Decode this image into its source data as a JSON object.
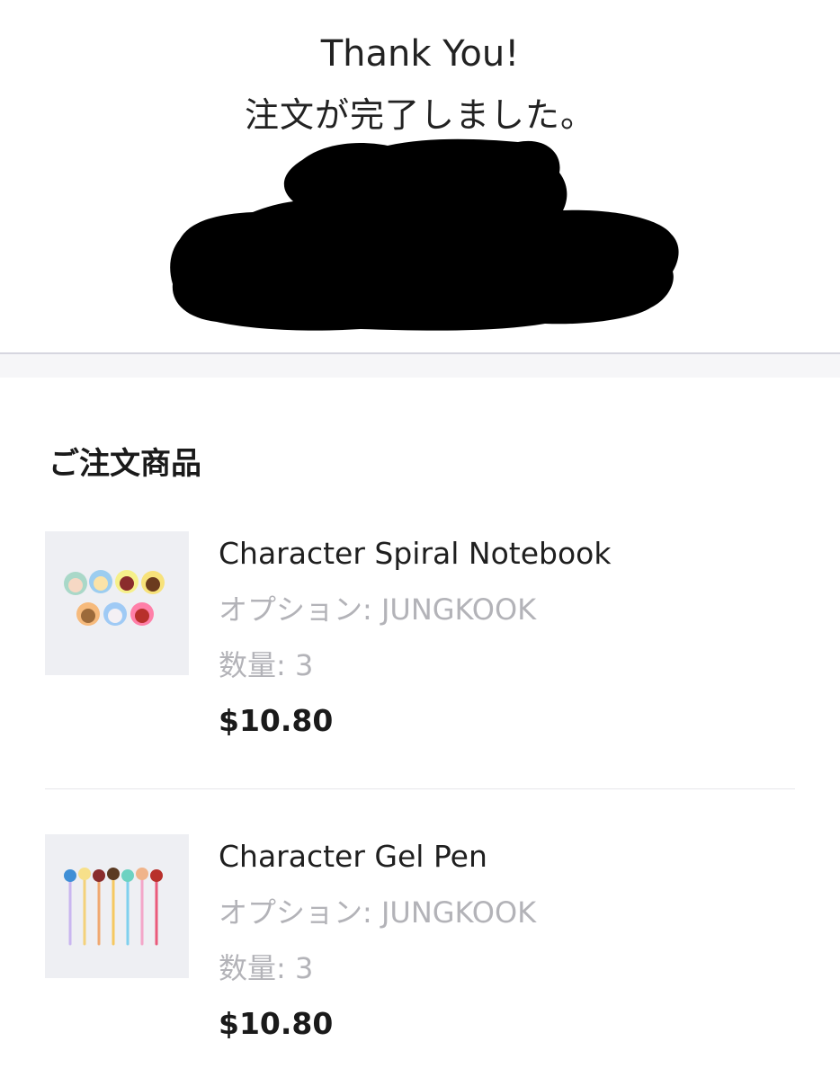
{
  "header": {
    "thank_you": "Thank You!",
    "order_complete": "注文が完了しました。"
  },
  "orders": {
    "section_title": "ご注文商品",
    "items": [
      {
        "name": "Character Spiral Notebook",
        "option": "オプション: JUNGKOOK",
        "quantity": "数量: 3",
        "price": "$10.80"
      },
      {
        "name": "Character Gel Pen",
        "option": "オプション: JUNGKOOK",
        "quantity": "数量: 3",
        "price": "$10.80"
      }
    ]
  }
}
